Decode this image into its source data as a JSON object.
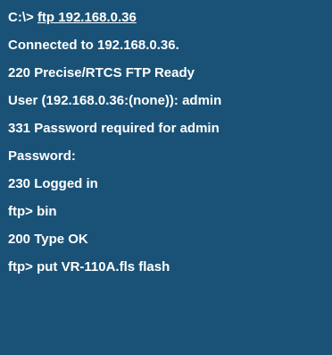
{
  "terminal": {
    "background": "#1a5277",
    "foreground": "#ffffff",
    "lines": [
      {
        "prefix": "C:\\> ",
        "text": "ftp 192.168.0.36"
      },
      {
        "text": "Connected to 192.168.0.36."
      },
      {
        "text": "220 Precise/RTCS FTP Ready"
      },
      {
        "text": "User (192.168.0.36:(none)): admin"
      },
      {
        "text": "331 Password required for admin"
      },
      {
        "text": "Password:"
      },
      {
        "text": "230 Logged in"
      },
      {
        "text": "ftp> bin"
      },
      {
        "text": "200 Type OK"
      },
      {
        "text": "ftp> put VR-110A.fls flash"
      }
    ]
  }
}
